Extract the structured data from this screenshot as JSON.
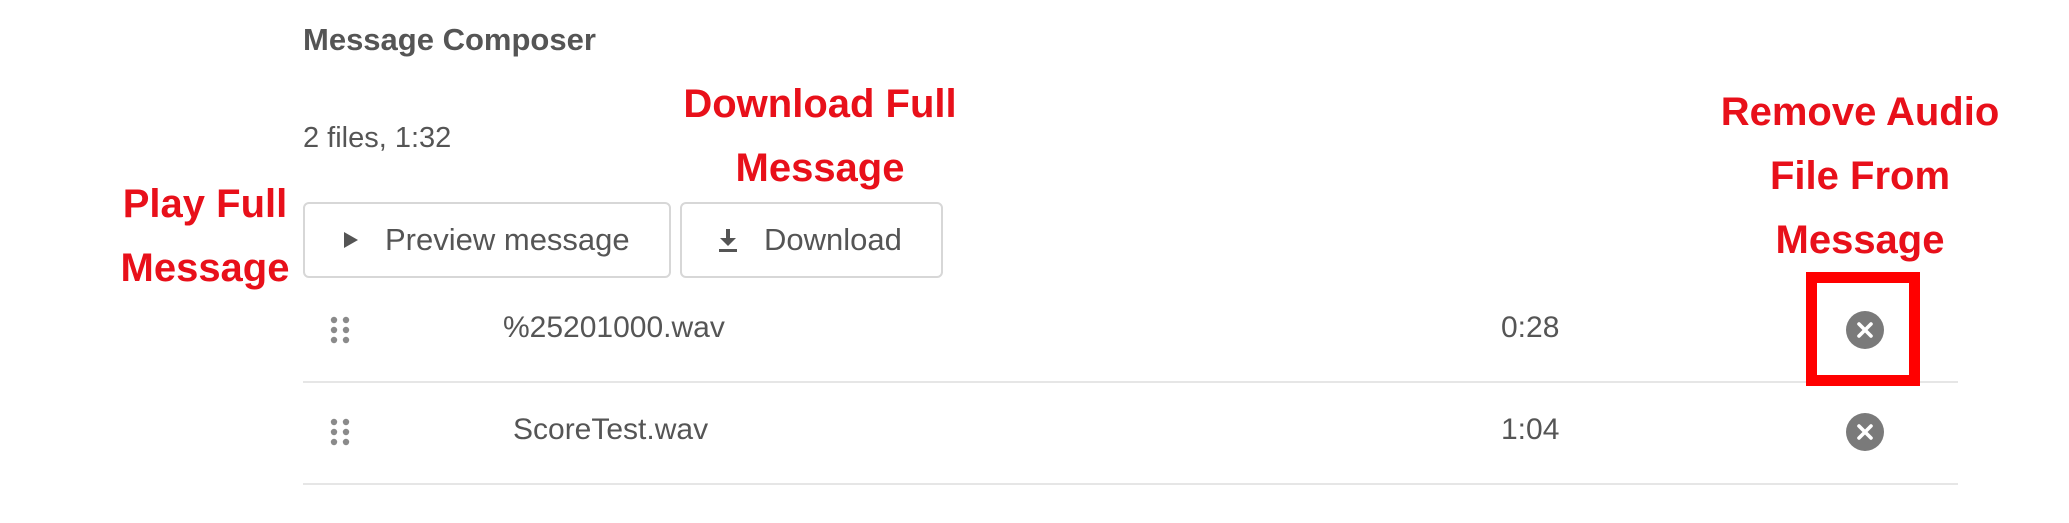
{
  "composer": {
    "title": "Message Composer",
    "summary": "2 files, 1:32"
  },
  "buttons": {
    "preview_label": "Preview message",
    "preview_icon": "play-icon",
    "download_label": "Download",
    "download_icon": "download-icon"
  },
  "files": [
    {
      "name": "%25201000.wav",
      "duration": "0:28",
      "remove_icon": "remove-circle-icon",
      "drag_icon": "drag-handle-icon"
    },
    {
      "name": "ScoreTest.wav",
      "duration": "1:04",
      "remove_icon": "remove-circle-icon",
      "drag_icon": "drag-handle-icon"
    }
  ],
  "annotations": {
    "play": [
      "Play Full",
      "Message"
    ],
    "download": [
      "Download Full",
      "Message"
    ],
    "remove": [
      "Remove Audio",
      "File From",
      "Message"
    ]
  },
  "colors": {
    "annotation_text": "#e8101a",
    "highlight_box": "#ff0000",
    "icon_gray": "#7a7a7a",
    "border": "#d7d7d7"
  }
}
